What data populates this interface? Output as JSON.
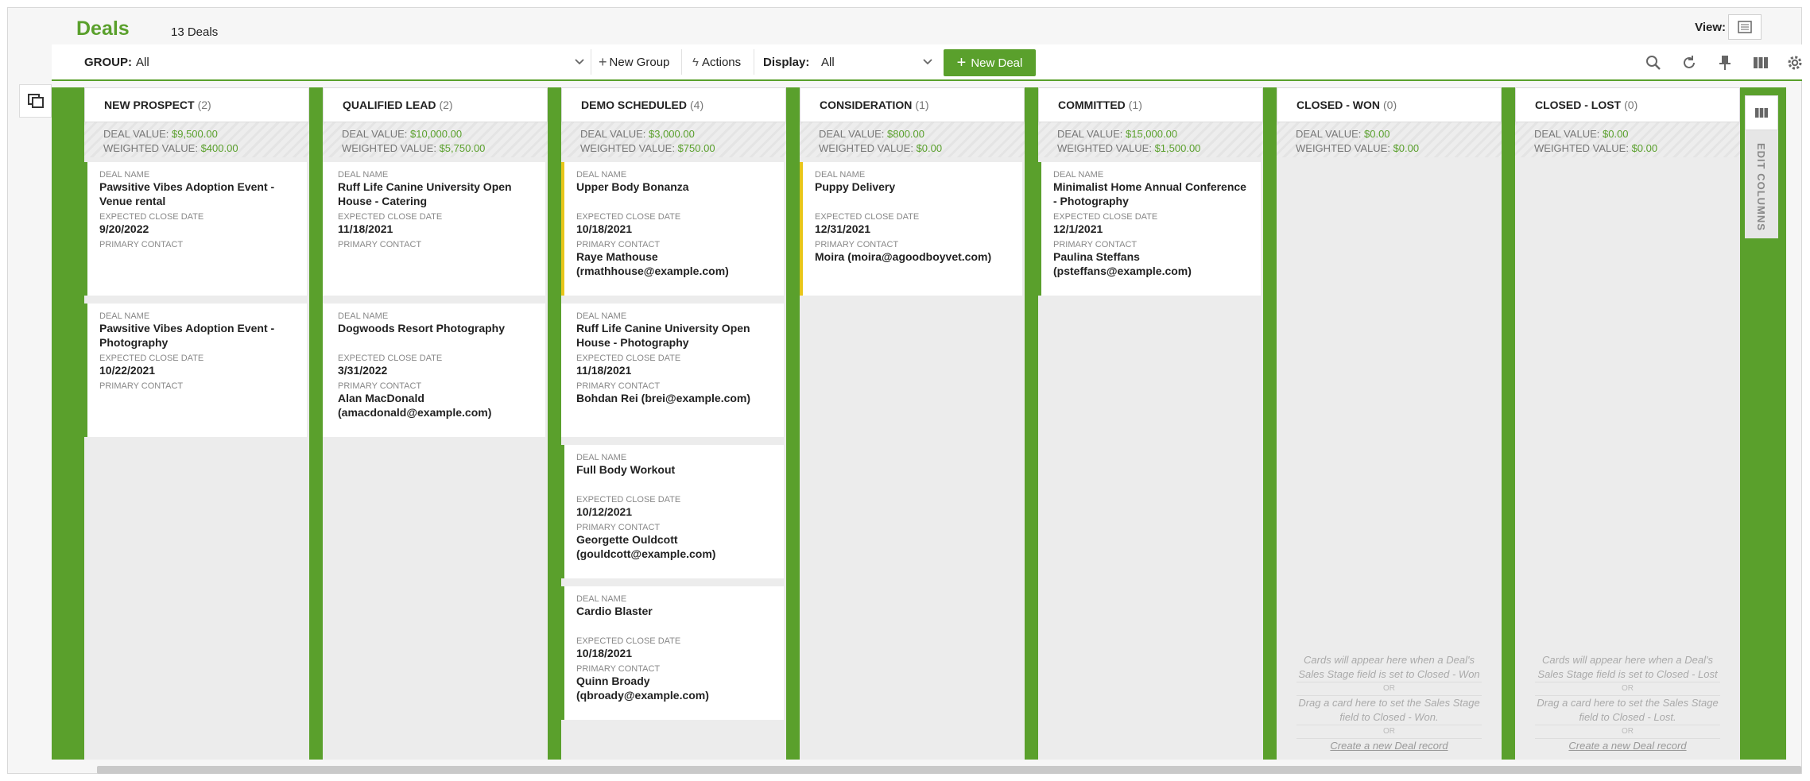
{
  "header": {
    "title": "Deals",
    "count": "13 Deals",
    "view_label": "View:"
  },
  "toolbar": {
    "group_label": "GROUP:",
    "group_value": "All",
    "new_group": "New Group",
    "actions": "Actions",
    "display_label": "Display:",
    "display_value": "All",
    "new_deal": "New Deal"
  },
  "labels": {
    "deal_value": "DEAL VALUE:",
    "weighted_value": "WEIGHTED VALUE:",
    "deal_name": "DEAL NAME",
    "close_date": "EXPECTED CLOSE DATE",
    "primary_contact": "PRIMARY CONTACT",
    "edit_columns": "EDIT COLUMNS"
  },
  "columns": [
    {
      "name": "NEW PROSPECT",
      "count": "(2)",
      "deal_value": "$9,500.00",
      "weighted_value": "$400.00",
      "cards": [
        {
          "name": "Pawsitive Vibes Adoption Event - Venue rental",
          "date": "9/20/2022",
          "contact": "",
          "color": "green"
        },
        {
          "name": "Pawsitive Vibes Adoption Event - Photography",
          "date": "10/22/2021",
          "contact": "",
          "color": "green"
        }
      ]
    },
    {
      "name": "QUALIFIED LEAD",
      "count": "(2)",
      "deal_value": "$10,000.00",
      "weighted_value": "$5,750.00",
      "cards": [
        {
          "name": "Ruff Life Canine University Open House - Catering",
          "date": "11/18/2021",
          "contact": "",
          "color": "none"
        },
        {
          "name": "Dogwoods Resort Photography",
          "date": "3/31/2022",
          "contact": "Alan MacDonald (amacdonald@example.com)",
          "color": "none"
        }
      ]
    },
    {
      "name": "DEMO SCHEDULED",
      "count": "(4)",
      "deal_value": "$3,000.00",
      "weighted_value": "$750.00",
      "cards": [
        {
          "name": "Upper Body Bonanza",
          "date": "10/18/2021",
          "contact": "Raye Mathouse (rmathhouse@example.com)",
          "color": "yellow"
        },
        {
          "name": "Ruff Life Canine University Open House - Photography",
          "date": "11/18/2021",
          "contact": "Bohdan Rei (brei@example.com)",
          "color": "none"
        },
        {
          "name": "Full Body Workout",
          "date": "10/12/2021",
          "contact": "Georgette Ouldcott (gouldcott@example.com)",
          "color": "green"
        },
        {
          "name": "Cardio Blaster",
          "date": "10/18/2021",
          "contact": "Quinn Broady (qbroady@example.com)",
          "color": "green"
        }
      ]
    },
    {
      "name": "CONSIDERATION",
      "count": "(1)",
      "deal_value": "$800.00",
      "weighted_value": "$0.00",
      "cards": [
        {
          "name": "Puppy Delivery",
          "date": "12/31/2021",
          "contact": "Moira (moira@agoodboyvet.com)",
          "color": "yellow"
        }
      ]
    },
    {
      "name": "COMMITTED",
      "count": "(1)",
      "deal_value": "$15,000.00",
      "weighted_value": "$1,500.00",
      "cards": [
        {
          "name": "Minimalist Home Annual Conference - Photography",
          "date": "12/1/2021",
          "contact": "Paulina Steffans (psteffans@example.com)",
          "color": "green"
        }
      ]
    },
    {
      "name": "CLOSED - WON",
      "count": "(0)",
      "deal_value": "$0.00",
      "weighted_value": "$0.00",
      "cards": [],
      "empty": {
        "line1": "Cards will appear here when a Deal's Sales Stage field is set to Closed - Won",
        "or1": "OR",
        "line2": "Drag a card here to set the Sales Stage field to Closed - Won.",
        "or2": "OR",
        "link": "Create a new Deal record"
      }
    },
    {
      "name": "CLOSED - LOST",
      "count": "(0)",
      "deal_value": "$0.00",
      "weighted_value": "$0.00",
      "cards": [],
      "empty": {
        "line1": "Cards will appear here when a Deal's Sales Stage field is set to Closed - Lost",
        "or1": "OR",
        "line2": "Drag a card here to set the Sales Stage field to Closed - Lost.",
        "or2": "OR",
        "link": "Create a new Deal record"
      }
    }
  ],
  "colors": {
    "accent": "#5aa02c",
    "warning": "#e8c619"
  }
}
